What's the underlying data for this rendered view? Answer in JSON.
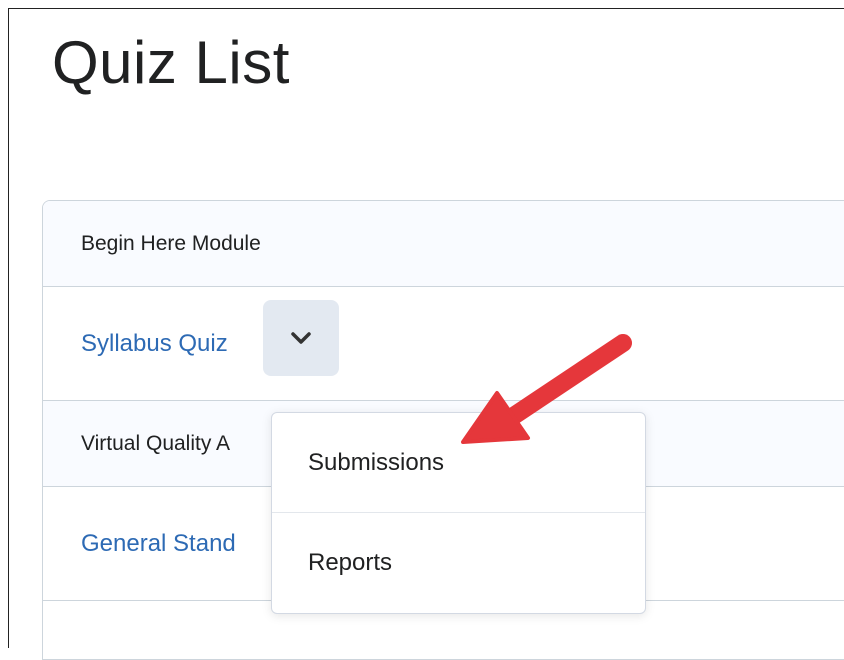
{
  "page": {
    "title": "Quiz List"
  },
  "quiz_list": {
    "rows": [
      {
        "type": "module",
        "label": "Begin Here Module"
      },
      {
        "type": "quiz",
        "label": "Syllabus Quiz"
      },
      {
        "type": "module",
        "label": "Virtual Quality A"
      },
      {
        "type": "quiz",
        "label": "General Stand"
      }
    ]
  },
  "context_menu": {
    "items": [
      {
        "label": "Submissions"
      },
      {
        "label": "Reports"
      }
    ]
  },
  "icons": {
    "row_menu": "chevron-down-icon",
    "callout": "red-arrow-icon"
  },
  "colors": {
    "link": "#2d6ab4",
    "module_row_bg": "#f9fbff",
    "menu_button_bg": "#e3e9f1",
    "callout_arrow": "#e5373b"
  }
}
